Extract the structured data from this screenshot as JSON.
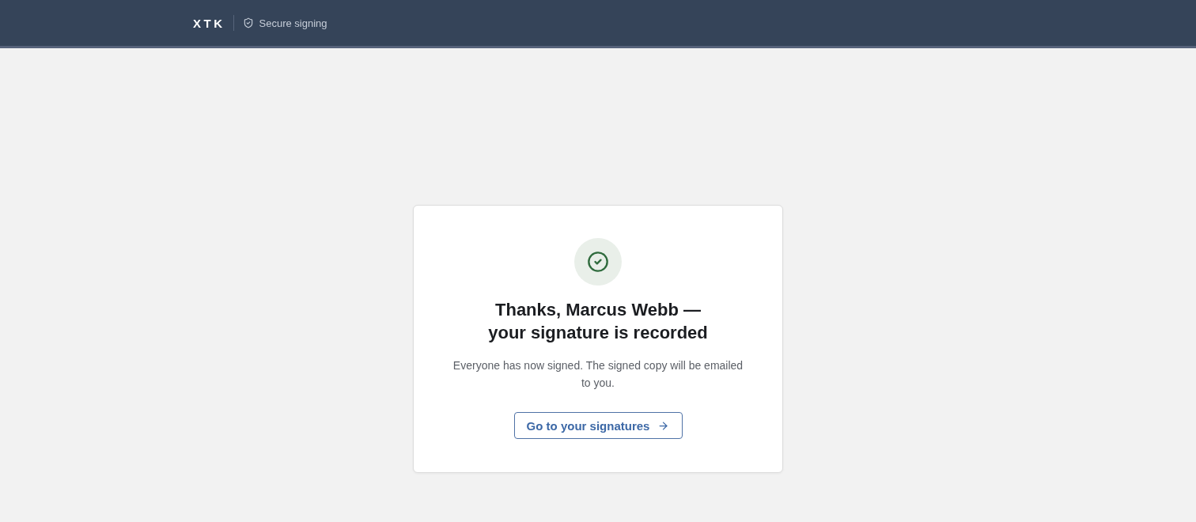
{
  "header": {
    "logo": "XTK",
    "badge": "Secure signing"
  },
  "confirmation": {
    "title": "Thanks, Marcus Webb — your signature is recorded",
    "message": "Everyone has now signed. The signed copy will be emailed to you.",
    "button": "Go to your signatures"
  }
}
